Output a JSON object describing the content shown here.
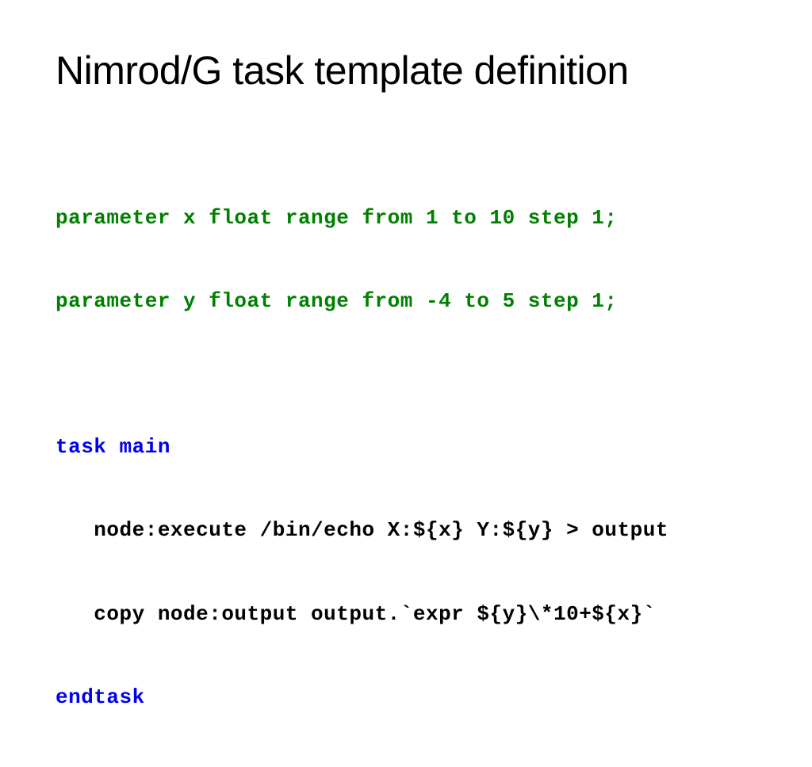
{
  "slide": {
    "title": "Nimrod/G task template definition",
    "code": {
      "param1": "parameter x float range from 1 to 10 step 1;",
      "param2": "parameter y float range from -4 to 5 step 1;",
      "task_keyword": "task main",
      "body1": "   node:execute /bin/echo X:${x} Y:${y} > output",
      "body2": "   copy node:output output.`expr ${y}\\*10+${x}`",
      "end_keyword": "endtask"
    }
  }
}
